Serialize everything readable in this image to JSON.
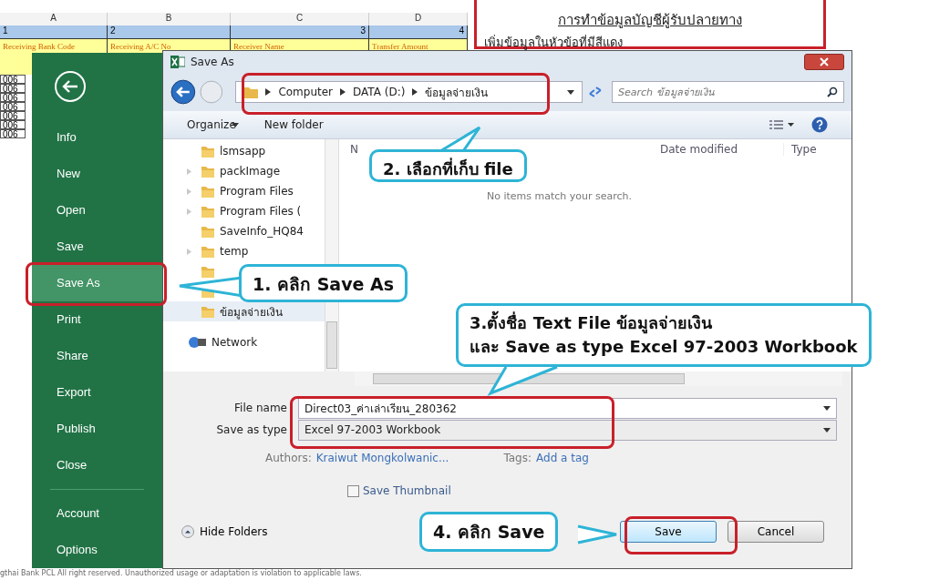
{
  "spreadsheet": {
    "column_headers": [
      "A",
      "B",
      "C",
      "D"
    ],
    "numbers": [
      "1",
      "2",
      "3",
      "4"
    ],
    "field_headers": [
      "Receiving Bank Code",
      "Receiving A/C No",
      "Receiver Name",
      "Transfer Amount"
    ],
    "rows": [
      "006",
      "006",
      "006",
      "006",
      "006",
      "006",
      "006"
    ]
  },
  "note": {
    "title": "การทำข้อมูลบัญชีผู้รับปลายทาง",
    "text": "เพิ่มข้อมูลในหัวข้อที่มีสีแดง"
  },
  "backstage": {
    "items": [
      {
        "label": "Info",
        "selected": false
      },
      {
        "label": "New",
        "selected": false
      },
      {
        "label": "Open",
        "selected": false
      },
      {
        "label": "Save",
        "selected": false
      },
      {
        "label": "Save As",
        "selected": true
      },
      {
        "label": "Print",
        "selected": false
      },
      {
        "label": "Share",
        "selected": false
      },
      {
        "label": "Export",
        "selected": false
      },
      {
        "label": "Publish",
        "selected": false
      },
      {
        "label": "Close",
        "selected": false
      }
    ],
    "footer_items": [
      "Account",
      "Options"
    ]
  },
  "dialog": {
    "title": "Save As",
    "breadcrumb": [
      "Computer",
      "DATA (D:)",
      "ข้อมูลจ่ายเงิน"
    ],
    "search": {
      "placeholder": "Search ข้อมูลจ่ายเงิน"
    },
    "toolbar": [
      "Organize",
      "New folder"
    ],
    "folders": [
      {
        "label": "lsmsapp",
        "has_children": false,
        "selected": false
      },
      {
        "label": "packImage",
        "has_children": true,
        "selected": false
      },
      {
        "label": "Program Files",
        "has_children": true,
        "selected": false
      },
      {
        "label": "Program Files (",
        "has_children": true,
        "selected": false
      },
      {
        "label": "SaveInfo_HQ84",
        "has_children": false,
        "selected": false
      },
      {
        "label": "temp",
        "has_children": true,
        "selected": false
      },
      {
        "has_children": false,
        "selected": false
      },
      {
        "has_children": false,
        "selected": false
      },
      {
        "label": "ข้อมูลจ่ายเงิน",
        "has_children": false,
        "selected": true
      }
    ],
    "network": "Network",
    "columns": [
      "N",
      "Date modified",
      "Type"
    ],
    "empty_message": "No items match your search.",
    "file_name": {
      "label": "File name",
      "value": "Direct03_ค่าเล่าเรียน_280362"
    },
    "save_type": {
      "label": "Save as type",
      "value": "Excel 97-2003 Workbook"
    },
    "authors": {
      "label": "Authors:",
      "value": "Kraiwut Mongkolwanic..."
    },
    "tags": {
      "label": "Tags:",
      "value": "Add a tag"
    },
    "thumbnail": {
      "label": "Save Thumbnail",
      "checked": false
    },
    "hide_folders": "Hide Folders",
    "buttons": [
      "Save",
      "Cancel"
    ]
  },
  "callouts": [
    {
      "text": "1. คลิก **Save As**"
    },
    {
      "text": "2. เลือกที่เก็บ file"
    },
    {
      "lines": [
        "3.ตั้งชื่อ **Text File ข้อมูลจ่ายเงิน**",
        "และ Save as type **Excel 97-2003 Workbook**"
      ]
    },
    {
      "text": "4. คลิก **Save**"
    }
  ],
  "copyright": "gthai Bank PCL All right reserved. Unauthorized usage or adaptation is violation to applicable laws."
}
